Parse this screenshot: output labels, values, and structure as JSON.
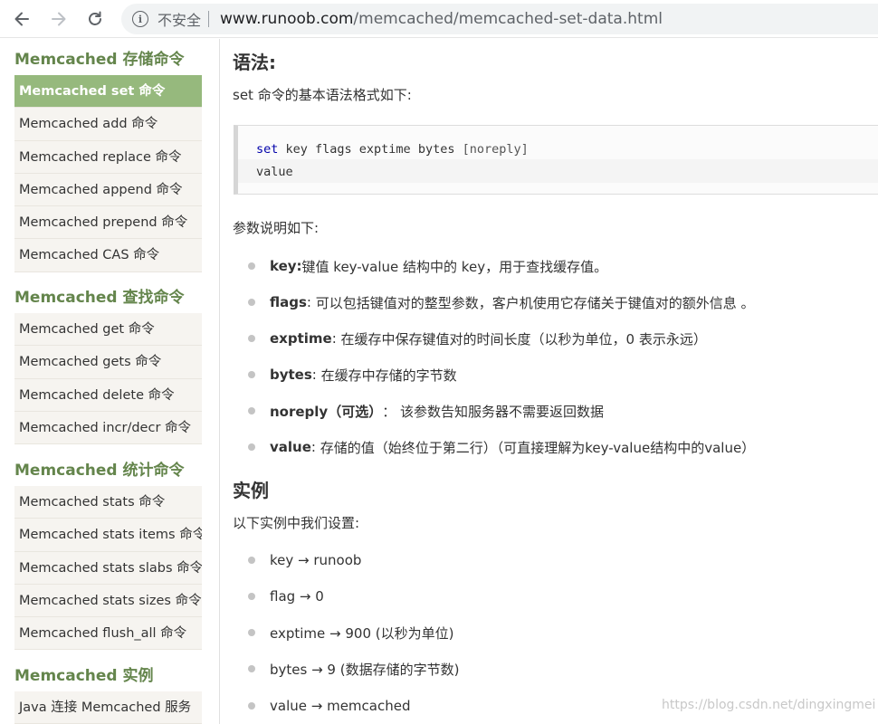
{
  "browser": {
    "security_label": "不安全",
    "url_host": "www.runoob.com",
    "url_path": "/memcached/memcached-set-data.html"
  },
  "sidebar": {
    "groups": [
      {
        "title": "Memcached 存储命令",
        "items": [
          {
            "label": "Memcached set 命令"
          },
          {
            "label": "Memcached add 命令"
          },
          {
            "label": "Memcached replace 命令"
          },
          {
            "label": "Memcached append 命令"
          },
          {
            "label": "Memcached prepend 命令"
          },
          {
            "label": "Memcached CAS 命令"
          }
        ]
      },
      {
        "title": "Memcached 查找命令",
        "items": [
          {
            "label": "Memcached get 命令"
          },
          {
            "label": "Memcached gets 命令"
          },
          {
            "label": "Memcached delete 命令"
          },
          {
            "label": "Memcached incr/decr 命令"
          }
        ]
      },
      {
        "title": "Memcached 统计命令",
        "items": [
          {
            "label": "Memcached stats 命令"
          },
          {
            "label": "Memcached stats items 命令"
          },
          {
            "label": "Memcached stats slabs 命令"
          },
          {
            "label": "Memcached stats sizes 命令"
          },
          {
            "label": "Memcached flush_all 命令"
          }
        ]
      },
      {
        "title": "Memcached 实例",
        "items": [
          {
            "label": "Java 连接 Memcached 服务"
          }
        ]
      }
    ],
    "active_item": "Memcached set 命令"
  },
  "main": {
    "syntax_heading": "语法:",
    "syntax_intro": "set 命令的基本语法格式如下:",
    "code": {
      "line1_cmd": "set",
      "line1_args": " key flags exptime bytes ",
      "line1_opt": "[noreply]",
      "line2": "value"
    },
    "params_intro": "参数说明如下:",
    "params": [
      {
        "name": "key",
        "sep": ":",
        "desc": "键值 key-value 结构中的 key，用于查找缓存值。"
      },
      {
        "name": "flags",
        "sep": ": ",
        "desc": "可以包括键值对的整型参数，客户机使用它存储关于键值对的额外信息 。"
      },
      {
        "name": "exptime",
        "sep": ": ",
        "desc": "在缓存中保存键值对的时间长度（以秒为单位，0 表示永远）"
      },
      {
        "name": "bytes",
        "sep": ": ",
        "desc": "在缓存中存储的字节数"
      },
      {
        "name": "noreply（可选）",
        "sep": "： ",
        "desc": "该参数告知服务器不需要返回数据"
      },
      {
        "name": "value",
        "sep": ": ",
        "desc": "存储的值（始终位于第二行）（可直接理解为key-value结构中的value）"
      }
    ],
    "example_heading": "实例",
    "example_intro": "以下实例中我们设置:",
    "examples": [
      {
        "text": "key → runoob"
      },
      {
        "text": "flag → 0"
      },
      {
        "text": "exptime → 900 (以秒为单位)"
      },
      {
        "text": "bytes → 9 (数据存储的字节数)"
      },
      {
        "text": "value → memcached"
      }
    ]
  },
  "watermark": "https://blog.csdn.net/dingxingmei"
}
